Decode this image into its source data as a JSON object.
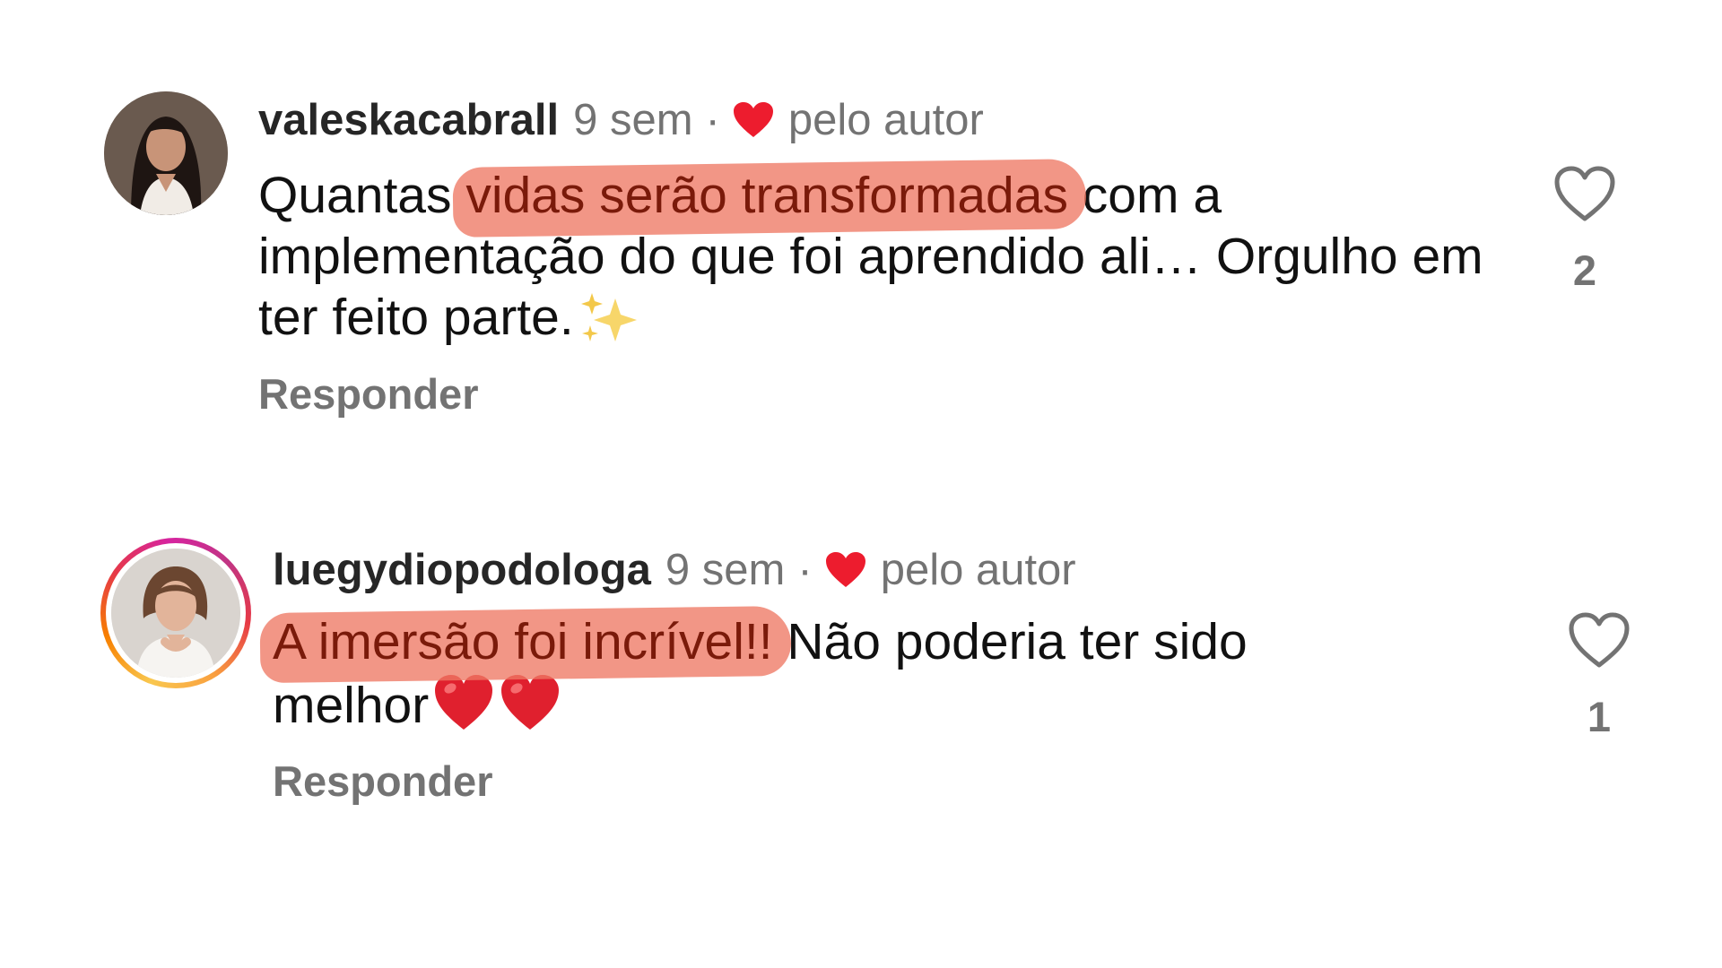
{
  "comments": [
    {
      "username": "valeskacabrall",
      "time": "9 sem",
      "separator": "·",
      "liked_by_author": "pelo autor",
      "text_before": "Quantas ",
      "text_highlight": "vidas serão transformadas",
      "text_after": " com a implementação do que foi aprendido ali… Orgulho em ter feito parte.",
      "reply_label": "Responder",
      "like_count": "2",
      "has_story_ring": false
    },
    {
      "username": "luegydiopodologa",
      "time": "9 sem",
      "separator": "·",
      "liked_by_author": "pelo autor",
      "text_before": "",
      "text_highlight": "A imersão foi incrível!!",
      "text_after": " Não poderia ter sido melhor",
      "reply_label": "Responder",
      "like_count": "1",
      "has_story_ring": true
    }
  ],
  "colors": {
    "highlight": "#ee7864",
    "heart_red": "#ed1c2e",
    "muted_text": "#737373"
  },
  "icons": {
    "author_like": "red-heart-icon",
    "like": "heart-outline-icon",
    "sparkles": "sparkles-emoji",
    "heart_emoji": "red-heart-emoji"
  }
}
